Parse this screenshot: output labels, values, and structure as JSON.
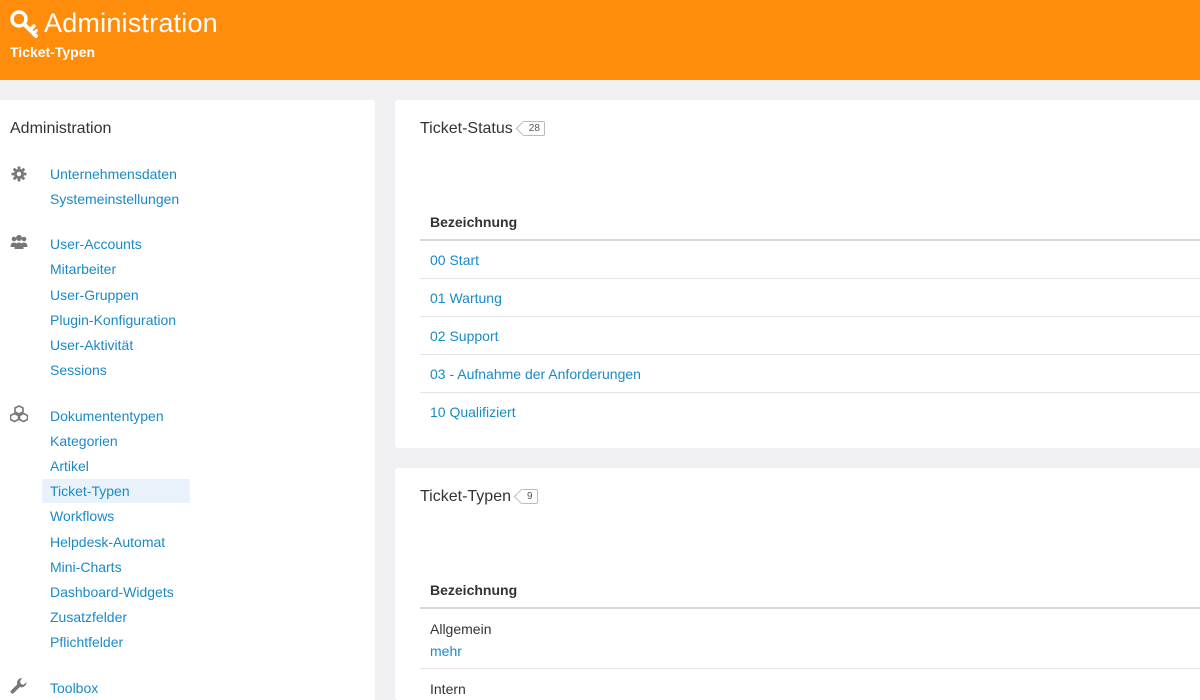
{
  "header": {
    "title": "Administration",
    "subtitle": "Ticket-Typen",
    "icon": "key-icon",
    "color": "#ff8c0a"
  },
  "sidebar": {
    "title": "Administration",
    "groups": [
      {
        "icon": "gear-icon",
        "items": [
          "Unternehmensdaten",
          "Systemeinstellungen"
        ]
      },
      {
        "icon": "users-icon",
        "items": [
          "User-Accounts",
          "Mitarbeiter",
          "User-Gruppen",
          "Plugin-Konfiguration",
          "User-Aktivität",
          "Sessions"
        ]
      },
      {
        "icon": "cubes-icon",
        "items": [
          "Dokumententypen",
          "Kategorien",
          "Artikel",
          "Ticket-Typen",
          "Workflows",
          "Helpdesk-Automat",
          "Mini-Charts",
          "Dashboard-Widgets",
          "Zusatzfelder",
          "Pflichtfelder"
        ]
      },
      {
        "icon": "wrench-icon",
        "items": [
          "Toolbox"
        ]
      }
    ],
    "active_item": "Ticket-Typen",
    "link_color": "#1a8ac7"
  },
  "ticket_status": {
    "title": "Ticket-Status",
    "count": "28",
    "column": "Bezeichnung",
    "rows": [
      "00 Start",
      "01 Wartung",
      "02 Support",
      "03 - Aufnahme der Anforderungen",
      "10 Qualifiziert"
    ]
  },
  "ticket_types": {
    "title": "Ticket-Typen",
    "count": "9",
    "column": "Bezeichnung",
    "rows": [
      {
        "name": "Allgemein",
        "more": "mehr"
      },
      {
        "name": "Intern"
      }
    ]
  }
}
